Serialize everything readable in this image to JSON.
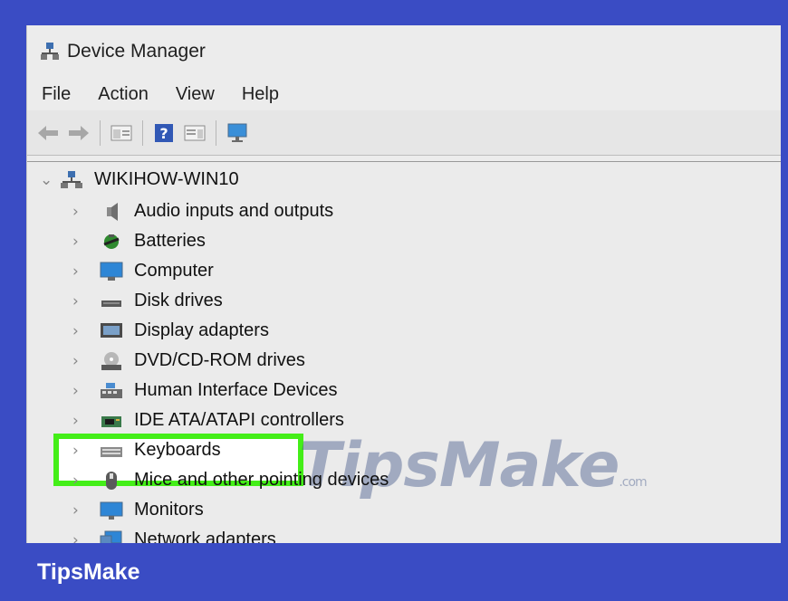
{
  "window": {
    "title": "Device Manager",
    "menu": [
      "File",
      "Action",
      "View",
      "Help"
    ]
  },
  "tree": {
    "root": "WIKIHOW-WIN10",
    "items": [
      {
        "label": "Audio inputs and outputs",
        "icon": "speaker-icon"
      },
      {
        "label": "Batteries",
        "icon": "battery-icon"
      },
      {
        "label": "Computer",
        "icon": "computer-icon"
      },
      {
        "label": "Disk drives",
        "icon": "disk-drive-icon"
      },
      {
        "label": "Display adapters",
        "icon": "display-adapter-icon"
      },
      {
        "label": "DVD/CD-ROM drives",
        "icon": "dvd-drive-icon"
      },
      {
        "label": "Human Interface Devices",
        "icon": "hid-icon"
      },
      {
        "label": "IDE ATA/ATAPI controllers",
        "icon": "ide-controller-icon"
      },
      {
        "label": "Keyboards",
        "icon": "keyboard-icon"
      },
      {
        "label": "Mice and other pointing devices",
        "icon": "mouse-icon"
      },
      {
        "label": "Monitors",
        "icon": "monitor-icon"
      },
      {
        "label": "Network adapters",
        "icon": "network-adapter-icon"
      }
    ]
  },
  "watermark": {
    "text": "TipsMake",
    "suffix": ".com"
  },
  "footer": {
    "brand": "TipsMake"
  },
  "colors": {
    "frame": "#3a4cc4",
    "highlight": "#44ee18"
  }
}
